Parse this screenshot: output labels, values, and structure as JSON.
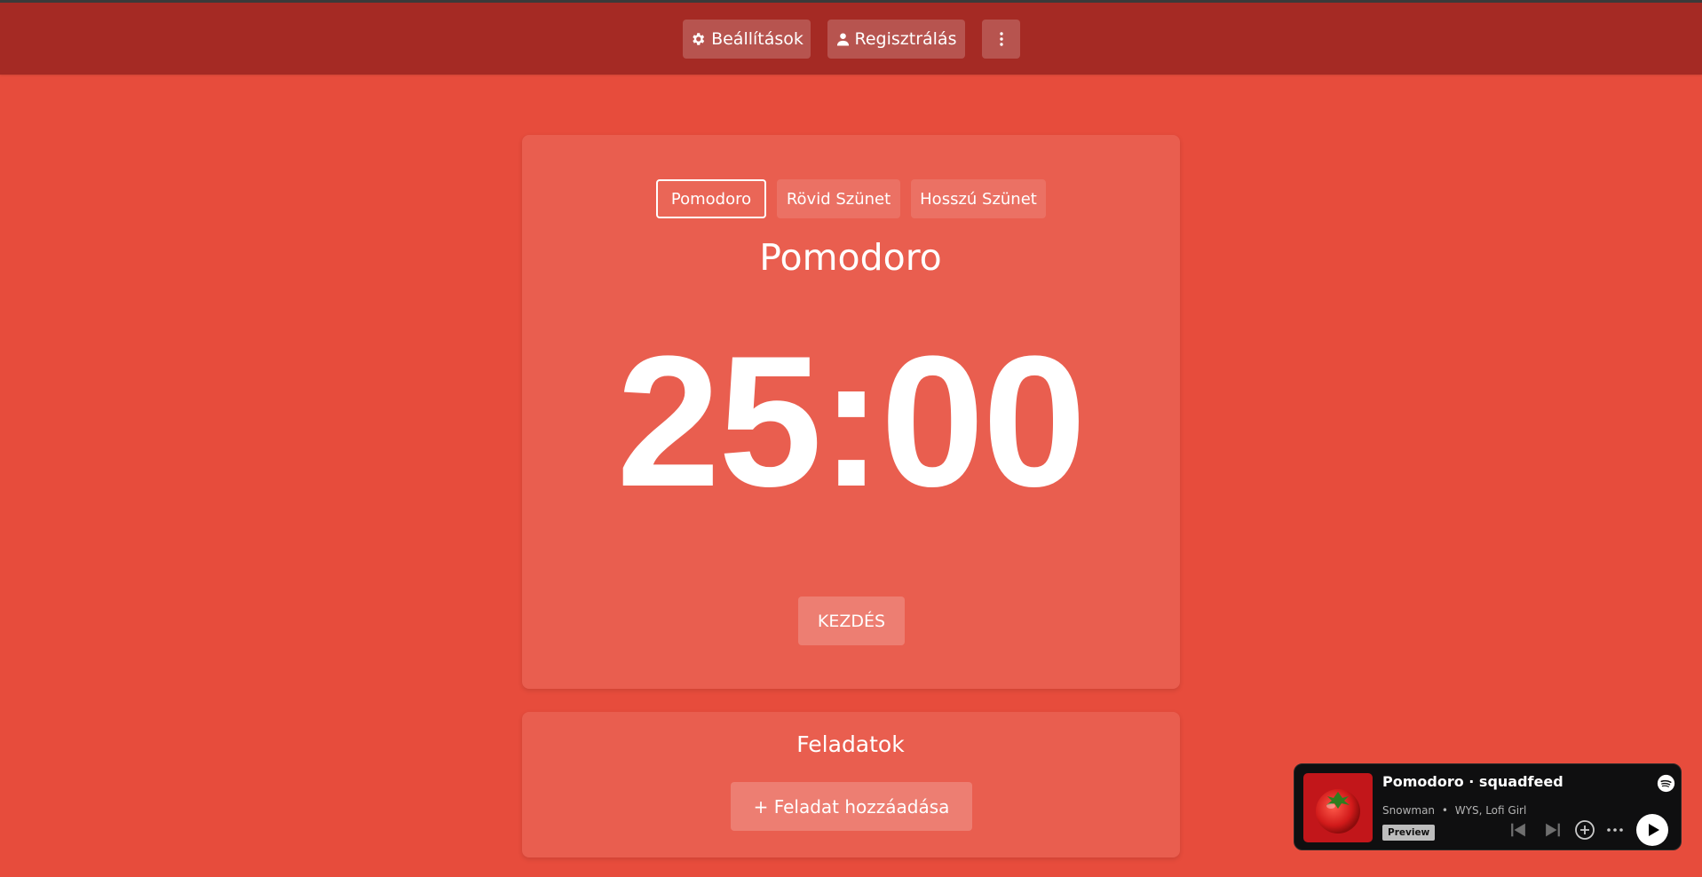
{
  "nav": {
    "settings_label": "Beállítások",
    "register_label": "Regisztrálás"
  },
  "timer": {
    "modes": [
      "Pomodoro",
      "Rövid Szünet",
      "Hosszú Szünet"
    ],
    "active_mode": "Pomodoro",
    "mode_title": "Pomodoro",
    "time": "25:00",
    "start_label": "KEZDÉS"
  },
  "tasks": {
    "title": "Feladatok",
    "add_label": "+ Feladat hozzáadása"
  },
  "player": {
    "title": "Pomodoro · squadfeed",
    "artist": "Snowman",
    "separator": "•",
    "featured": "WYS, Lofi Girl",
    "preview_badge": "Preview"
  },
  "colors": {
    "background": "#e74c3c",
    "topbar": "#a52a24",
    "player_bg": "#0f0f10"
  }
}
